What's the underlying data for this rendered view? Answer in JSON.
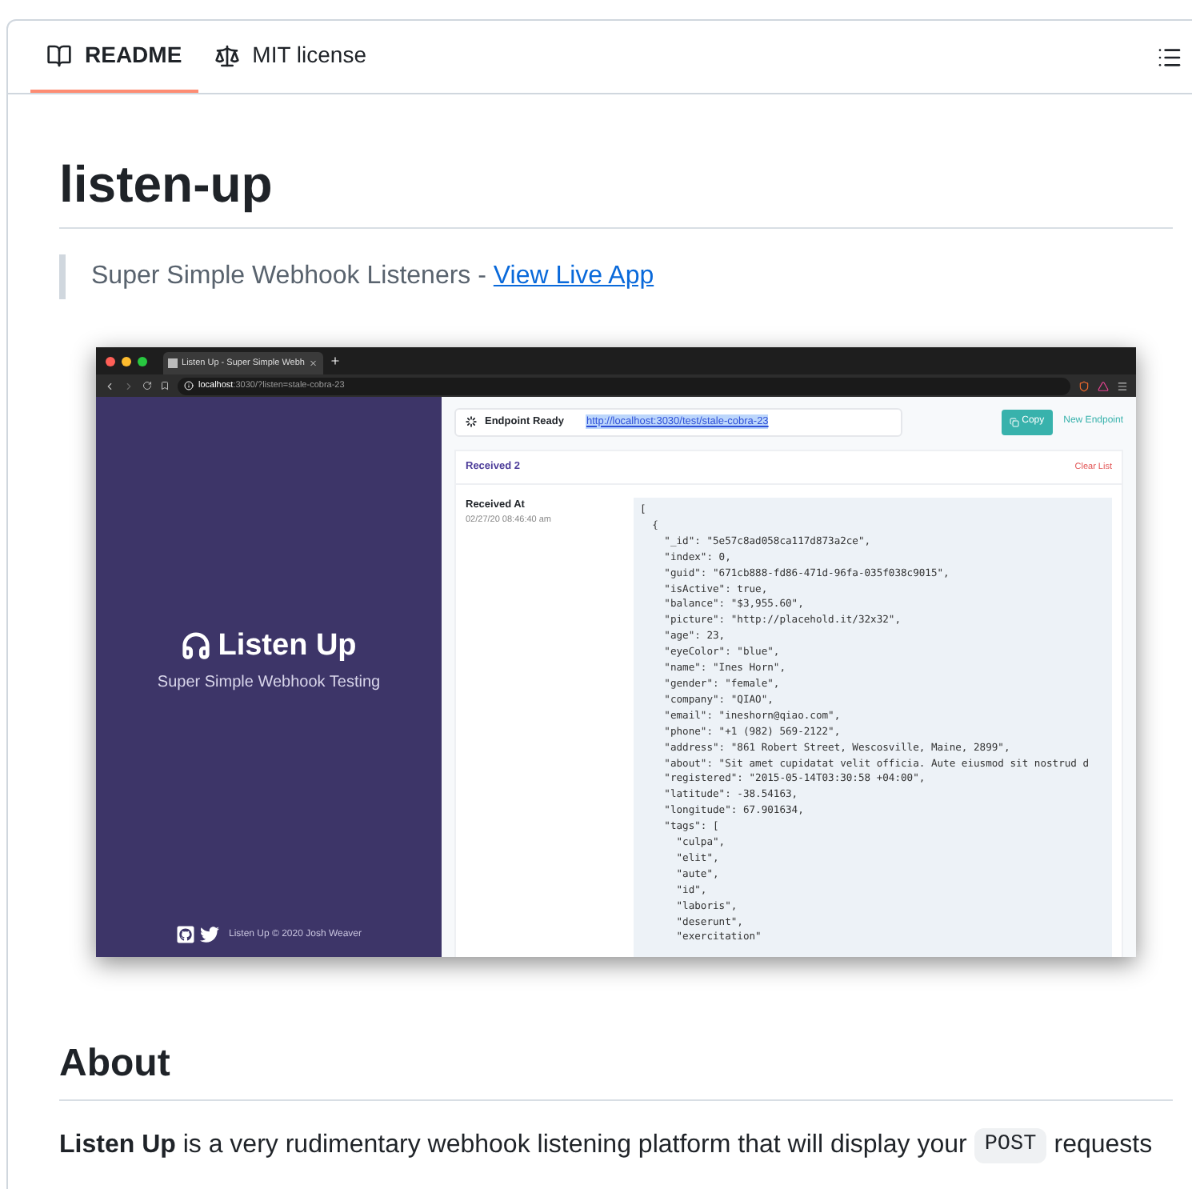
{
  "tabs": [
    {
      "label": "README",
      "kind": "book",
      "selected": true
    },
    {
      "label": "MIT license",
      "kind": "scale",
      "selected": false
    }
  ],
  "title": "listen-up",
  "quote": {
    "text": "Super Simple Webhook Listeners - ",
    "link": "View Live App"
  },
  "screenshot": {
    "browser_tab": "Listen Up - Super Simple Webh",
    "url_host": "localhost",
    "url_rest": ":3030/?listen=stale-cobra-23",
    "brand": "Listen Up",
    "tagline": "Super Simple Webhook Testing",
    "footer": "Listen Up © 2020 Josh Weaver",
    "status": "Endpoint Ready",
    "endpoint_url": "http://localhost:3030/test/stale-cobra-23",
    "copy_button": "Copy",
    "new_endpoint": "New Endpoint",
    "received": "Received 2",
    "clear": "Clear List",
    "column_header": "Received At",
    "timestamp": "02/27/20 08:46:40 am",
    "json_lines": [
      "[",
      "  {",
      "    \"_id\": \"5e57c8ad058ca117d873a2ce\",",
      "    \"index\": 0,",
      "    \"guid\": \"671cb888-fd86-471d-96fa-035f038c9015\",",
      "    \"isActive\": true,",
      "    \"balance\": \"$3,955.60\",",
      "    \"picture\": \"http://placehold.it/32x32\",",
      "    \"age\": 23,",
      "    \"eyeColor\": \"blue\",",
      "    \"name\": \"Ines Horn\",",
      "    \"gender\": \"female\",",
      "    \"company\": \"QIAO\",",
      "    \"email\": \"ineshorn@qiao.com\",",
      "    \"phone\": \"+1 (982) 569-2122\",",
      "    \"address\": \"861 Robert Street, Wescosville, Maine, 2899\",",
      "    \"about\": \"Sit amet cupidatat velit officia. Aute eiusmod sit nostrud d",
      "    \"registered\": \"2015-05-14T03:30:58 +04:00\",",
      "    \"latitude\": -38.54163,",
      "    \"longitude\": 67.901634,",
      "    \"tags\": [",
      "      \"culpa\",",
      "      \"elit\",",
      "      \"aute\",",
      "      \"id\",",
      "      \"laboris\",",
      "      \"deserunt\",",
      "      \"exercitation\""
    ]
  },
  "about": {
    "heading": "About",
    "before": "**Listen Up** is a very rudimentary webhook listening platform that will display your",
    "code": "POST",
    "after": "requests"
  }
}
